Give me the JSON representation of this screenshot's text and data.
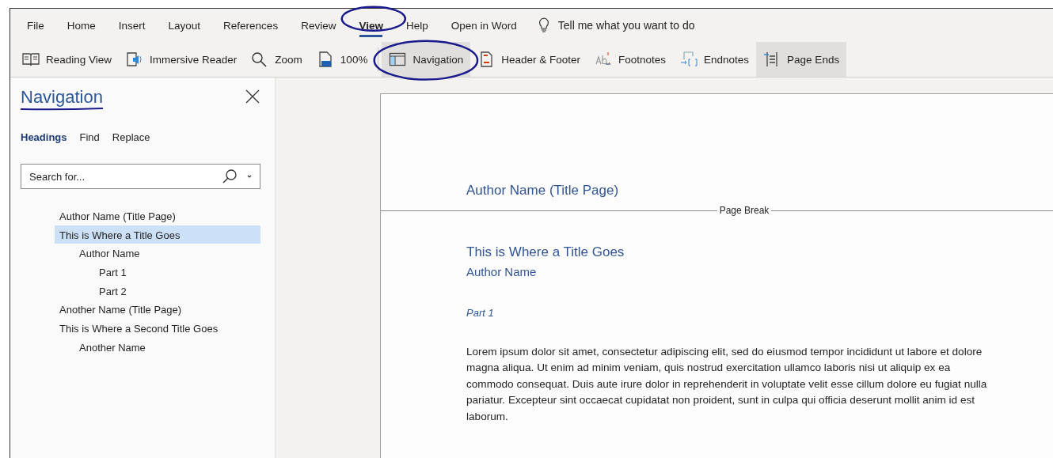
{
  "menu": [
    {
      "label": "File",
      "selected": false,
      "circled": false
    },
    {
      "label": "Home",
      "selected": false,
      "circled": false
    },
    {
      "label": "Insert",
      "selected": false,
      "circled": false
    },
    {
      "label": "Layout",
      "selected": false,
      "circled": false
    },
    {
      "label": "References",
      "selected": false,
      "circled": false
    },
    {
      "label": "Review",
      "selected": false,
      "circled": false
    },
    {
      "label": "View",
      "selected": true,
      "circled": true
    },
    {
      "label": "Help",
      "selected": false,
      "circled": false
    },
    {
      "label": "Open in Word",
      "selected": false,
      "circled": false
    }
  ],
  "tell_me": {
    "placeholder": "Tell me what you want to do"
  },
  "toolbar": [
    {
      "label": "Reading View",
      "checked": false,
      "circled": false
    },
    {
      "label": "Immersive Reader",
      "checked": false,
      "circled": false
    },
    {
      "label": "Zoom",
      "checked": false,
      "circled": false
    },
    {
      "label": "100%",
      "checked": false,
      "circled": false
    },
    {
      "label": "Navigation",
      "checked": true,
      "circled": true
    },
    {
      "label": "Header & Footer",
      "checked": false,
      "circled": false
    },
    {
      "label": "Footnotes",
      "checked": false,
      "circled": false
    },
    {
      "label": "Endnotes",
      "checked": false,
      "circled": false
    },
    {
      "label": "Page Ends",
      "checked": true,
      "circled": false
    }
  ],
  "navigation_pane": {
    "title": "Navigation",
    "title_underlined": true,
    "tabs": [
      {
        "label": "Headings",
        "selected": true
      },
      {
        "label": "Find",
        "selected": false
      },
      {
        "label": "Replace",
        "selected": false
      }
    ],
    "search": {
      "placeholder": "Search for..."
    },
    "headings": [
      {
        "label": "Author Name (Title Page)",
        "selected": false
      },
      {
        "label": "This is Where a Title Goes",
        "selected": true,
        "children": [
          {
            "label": "Author Name",
            "selected": false,
            "children": [
              {
                "label": "Part 1",
                "selected": false
              },
              {
                "label": "Part 2",
                "selected": false
              }
            ]
          }
        ]
      },
      {
        "label": "Another Name (Title Page)",
        "selected": false
      },
      {
        "label": "This is Where a Second Title Goes",
        "selected": false,
        "children": [
          {
            "label": "Another Name",
            "selected": false
          }
        ]
      }
    ]
  },
  "document": [
    {
      "kind": "title-page",
      "text": "Author Name (Title Page)"
    },
    {
      "kind": "page-break",
      "text": "Page Break"
    },
    {
      "kind": "title",
      "text": "This is Where a Title Goes"
    },
    {
      "kind": "subtitle",
      "text": "Author Name"
    },
    {
      "kind": "heading",
      "text": "Part 1"
    },
    {
      "kind": "paragraph",
      "text": "Lorem ipsum dolor sit amet, consectetur adipiscing elit, sed do eiusmod tempor incididunt ut labore et dolore magna aliqua. Ut enim ad minim veniam, quis nostrud exercitation ullamco laboris nisi ut aliquip ex ea commodo consequat. Duis aute irure dolor in reprehenderit in voluptate velit esse cillum dolore eu fugiat nulla pariatur. Excepteur sint occaecat cupidatat non proident, sunt in culpa qui officia deserunt mollit anim id est laborum."
    }
  ]
}
